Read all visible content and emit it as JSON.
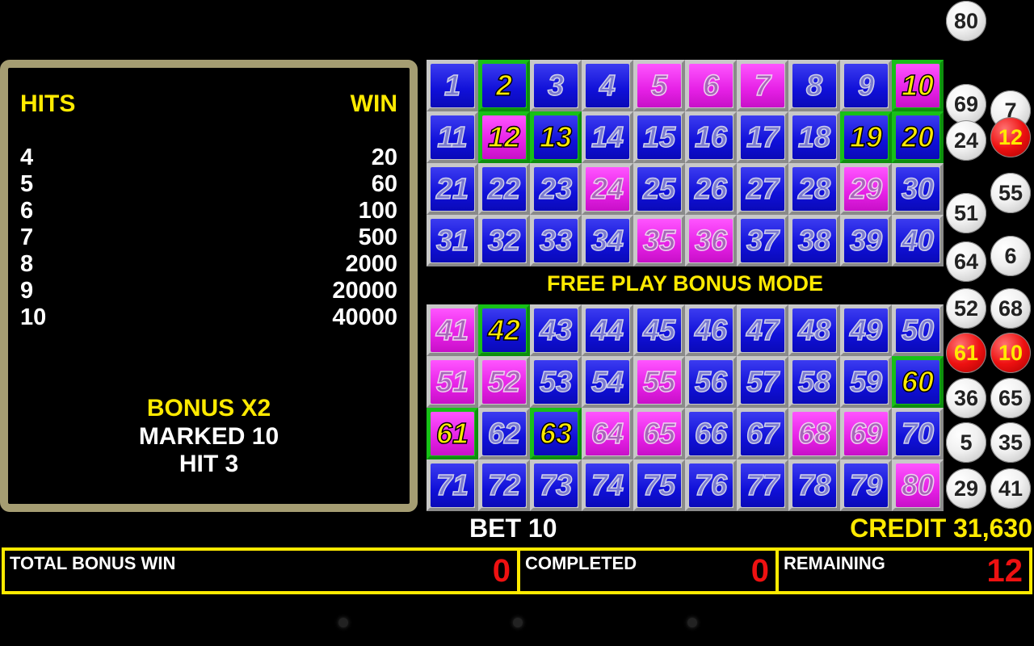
{
  "paytable": {
    "hits_header": "HITS",
    "win_header": "WIN",
    "rows": [
      {
        "hits": "4",
        "win": "20"
      },
      {
        "hits": "5",
        "win": "60"
      },
      {
        "hits": "6",
        "win": "100"
      },
      {
        "hits": "7",
        "win": "500"
      },
      {
        "hits": "8",
        "win": "2000"
      },
      {
        "hits": "9",
        "win": "20000"
      },
      {
        "hits": "10",
        "win": "40000"
      }
    ],
    "bonus_text": "BONUS X2",
    "marked_text": "MARKED 10",
    "hit_text": "HIT 3"
  },
  "mode_text": "FREE PLAY BONUS MODE",
  "bet_text": "BET 10",
  "credit_text": "CREDIT 31,630",
  "board": {
    "marked": [
      2,
      10,
      12,
      13,
      19,
      20,
      42,
      60,
      61,
      63
    ],
    "drawn": [
      5,
      6,
      7,
      10,
      12,
      24,
      29,
      35,
      36,
      41,
      51,
      52,
      55,
      61,
      64,
      65,
      68,
      69,
      80
    ]
  },
  "drawn_balls": [
    {
      "n": "80",
      "red": false
    },
    {
      "n": "69",
      "red": false
    },
    {
      "n": "7",
      "red": false
    },
    {
      "n": "24",
      "red": false
    },
    {
      "n": "12",
      "red": true
    },
    {
      "n": "55",
      "red": false
    },
    {
      "n": "51",
      "red": false
    },
    {
      "n": "64",
      "red": false
    },
    {
      "n": "6",
      "red": false
    },
    {
      "n": "52",
      "red": false
    },
    {
      "n": "68",
      "red": false
    },
    {
      "n": "61",
      "red": true
    },
    {
      "n": "10",
      "red": true
    },
    {
      "n": "36",
      "red": false
    },
    {
      "n": "65",
      "red": false
    },
    {
      "n": "5",
      "red": false
    },
    {
      "n": "35",
      "red": false
    },
    {
      "n": "29",
      "red": false
    },
    {
      "n": "41",
      "red": false
    }
  ],
  "status": {
    "total_bonus_win_label": "TOTAL BONUS WIN",
    "total_bonus_win_value": "0",
    "completed_label": "COMPLETED",
    "completed_value": "0",
    "remaining_label": "REMAINING",
    "remaining_value": "12"
  },
  "colors": {
    "accent_yellow": "#ffea00",
    "cell_blue": "#1818e0",
    "cell_pink": "#e520e5",
    "mark_green": "#18c018",
    "value_red": "#ee1111",
    "frame": "#a59d72"
  }
}
